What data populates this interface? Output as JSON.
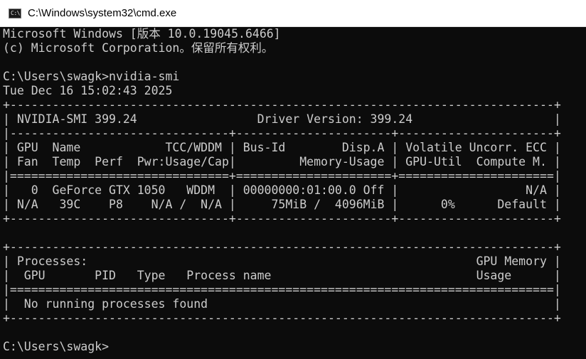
{
  "window": {
    "title": "C:\\Windows\\system32\\cmd.exe",
    "icon": "cmd-icon",
    "icon_glyph": "C:\\"
  },
  "console": {
    "lines": [
      "Microsoft Windows [版本 10.0.19045.6466]",
      "(c) Microsoft Corporation。保留所有权利。",
      "",
      "C:\\Users\\swagk>nvidia-smi",
      "Tue Dec 16 15:02:43 2025",
      "+-----------------------------------------------------------------------------+",
      "| NVIDIA-SMI 399.24                 Driver Version: 399.24                    |",
      "|-------------------------------+----------------------+----------------------+",
      "| GPU  Name            TCC/WDDM | Bus-Id        Disp.A | Volatile Uncorr. ECC |",
      "| Fan  Temp  Perf  Pwr:Usage/Cap|         Memory-Usage | GPU-Util  Compute M. |",
      "|===============================+======================+======================|",
      "|   0  GeForce GTX 1050   WDDM  | 00000000:01:00.0 Off |                  N/A |",
      "| N/A   39C    P8    N/A /  N/A |     75MiB /  4096MiB |      0%      Default |",
      "+-------------------------------+----------------------+----------------------+",
      "",
      "+-----------------------------------------------------------------------------+",
      "| Processes:                                                       GPU Memory |",
      "|  GPU       PID   Type   Process name                             Usage      |",
      "|=============================================================================|",
      "|  No running processes found                                                 |",
      "+-----------------------------------------------------------------------------+",
      "",
      "C:\\Users\\swagk>"
    ]
  },
  "colors": {
    "terminal_background": "#0c0c0c",
    "terminal_text": "#cccccc",
    "titlebar_background": "#ffffff"
  }
}
